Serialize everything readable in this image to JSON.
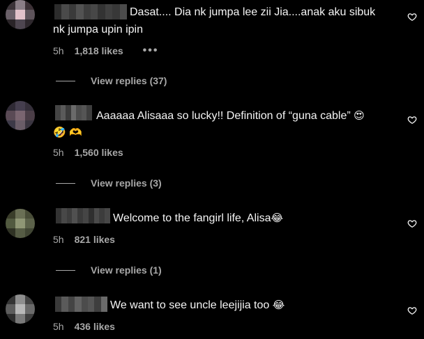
{
  "comments": [
    {
      "text_line1": "Dasat.... Dia nk jumpa lee zii Jia....anak aku sibuk",
      "text_line2": "nk jumpa upin ipin",
      "time": "5h",
      "likes": "1,818 likes",
      "more": "•••",
      "replies": "View replies (37)",
      "avatar_colors": [
        "#3b3338",
        "#8a7e86",
        "#3c3136",
        "#6a6068",
        "#e2c2ca",
        "#5e545b",
        "#2a2428",
        "#4e4650",
        "#2e282d"
      ],
      "username_colors": [
        "#2c2c2c",
        "#4a4a4a",
        "#3a3a3a",
        "#525252",
        "#3e3e3e",
        "#474747",
        "#333333",
        "#404040",
        "#383838",
        "#4b4b4b"
      ]
    },
    {
      "text_line1": "Aaaaaa Alisaaa so lucky!! Definition of “guna cable”",
      "emoji1": "😍",
      "emoji_line2a": "🤣",
      "emoji_line2b": "🫶",
      "time": "5h",
      "likes": "1,560 likes",
      "replies": "View replies (3)",
      "avatar_colors": [
        "#2f2a35",
        "#453e4e",
        "#352f3a",
        "#5a4a55",
        "#7a6570",
        "#4b3e47",
        "#3d3a48",
        "#6a5d68",
        "#3a3540"
      ],
      "username_colors": [
        "#444",
        "#5a5a5a",
        "#3b3b3b",
        "#6a6a6a",
        "#4c4c4c",
        "#555",
        "#3e3e3e"
      ]
    },
    {
      "text": "Welcome to the fangirl life, Alisa",
      "emoji": "😂",
      "time": "5h",
      "likes": "821 likes",
      "replies": "View replies (1)",
      "avatar_colors": [
        "#3a3d2a",
        "#6a6f55",
        "#494d38",
        "#525a40",
        "#8f9675",
        "#5c624a",
        "#2f3224",
        "#565c45",
        "#414634"
      ],
      "username_colors": [
        "#333",
        "#484848",
        "#3d3d3d",
        "#505050",
        "#3a3a3a",
        "#454545",
        "#2f2f2f",
        "#4a4a4a",
        "#3c3c3c",
        "#474747"
      ]
    },
    {
      "text": "We want to see uncle leejijia too",
      "emoji": "😂",
      "time": "5h",
      "likes": "436 likes",
      "avatar_colors": [
        "#353535",
        "#8f8f8f",
        "#454545",
        "#5d5d5d",
        "#b8b8b8",
        "#6a6a6a",
        "#2f2f2f",
        "#7a7a7a",
        "#3d3d3d"
      ],
      "username_colors": [
        "#3a3a3a",
        "#5a5a5a",
        "#444",
        "#626262",
        "#4c4c4c",
        "#555",
        "#3e3e3e",
        "#6a6a6a"
      ]
    }
  ],
  "icons": {
    "heart": "heart-icon"
  }
}
